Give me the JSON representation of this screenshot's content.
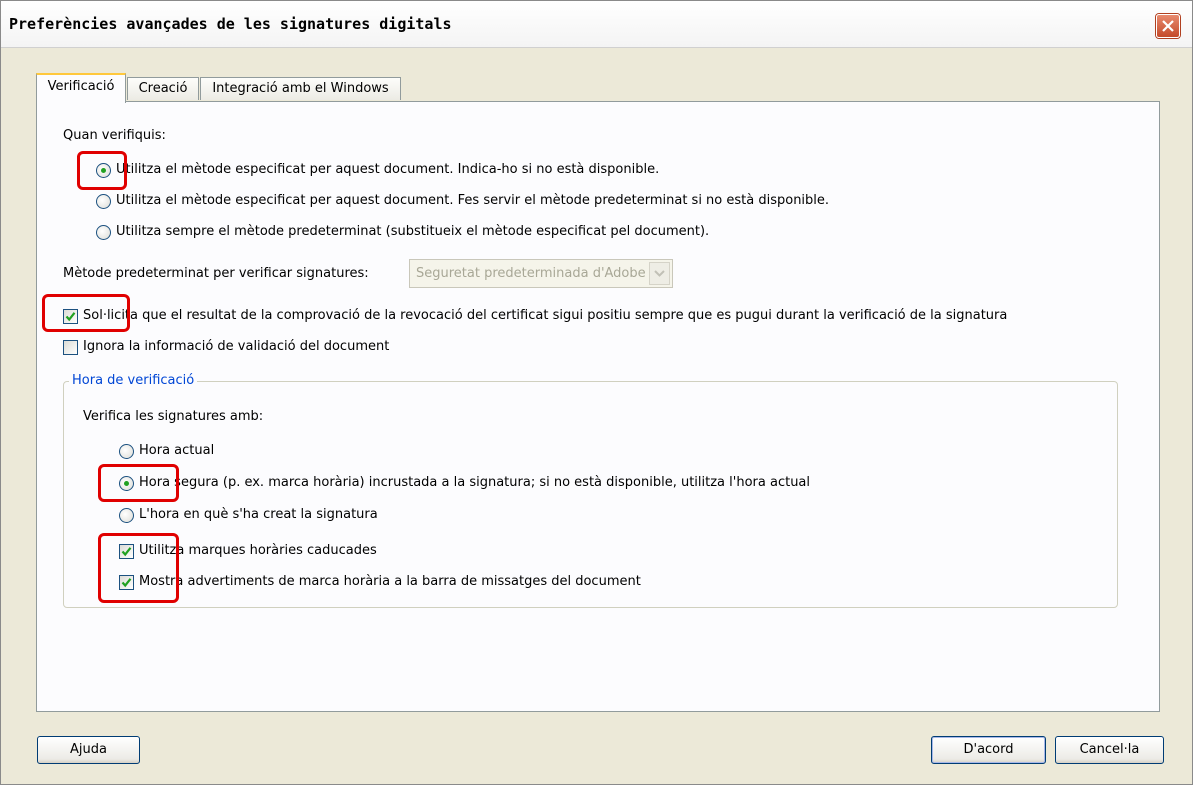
{
  "window": {
    "title": "Preferències avançades de les signatures digitals"
  },
  "tabs": [
    {
      "label": "Verificació",
      "active": true
    },
    {
      "label": "Creació",
      "active": false
    },
    {
      "label": "Integració amb el Windows",
      "active": false
    }
  ],
  "verification": {
    "heading": "Quan verifiquis:",
    "options": [
      {
        "label": "Utilitza el mètode especificat per aquest document. Indica-ho si no està disponible.",
        "selected": true
      },
      {
        "label": "Utilitza el mètode especificat per aquest document. Fes servir el mètode predeterminat si no està disponible.",
        "selected": false
      },
      {
        "label": "Utilitza sempre el mètode predeterminat (substitueix el mètode especificat pel document).",
        "selected": false
      }
    ],
    "default_method_label": "Mètode predeterminat per verificar signatures:",
    "default_method_value": "Seguretat predeterminada d'Adobe",
    "checkboxes": [
      {
        "label": "Sol·licita que el resultat de la comprovació de la revocació del certificat sigui positiu sempre que es pugui durant la verificació de la signatura",
        "checked": true
      },
      {
        "label": "Ignora la informació de validació del document",
        "checked": false
      }
    ]
  },
  "verification_time": {
    "group_title": "Hora de verificació",
    "subheading": "Verifica les signatures amb:",
    "options": [
      {
        "label": "Hora actual",
        "selected": false
      },
      {
        "label": "Hora segura (p. ex. marca horària) incrustada a la signatura; si no està disponible, utilitza l'hora actual",
        "selected": true
      },
      {
        "label": "L'hora en què s'ha creat la signatura",
        "selected": false
      }
    ],
    "checkboxes": [
      {
        "label": "Utilitza marques horàries caducades",
        "checked": true
      },
      {
        "label": "Mostra advertiments de marca horària a la barra de missatges del document",
        "checked": true
      }
    ]
  },
  "buttons": {
    "help": "Ajuda",
    "ok": "D'acord",
    "cancel": "Cancel·la"
  },
  "colors": {
    "highlight": "#e00000",
    "radio_dot": "#21a121",
    "checkmark": "#21a121",
    "group_title": "#0046d5"
  }
}
